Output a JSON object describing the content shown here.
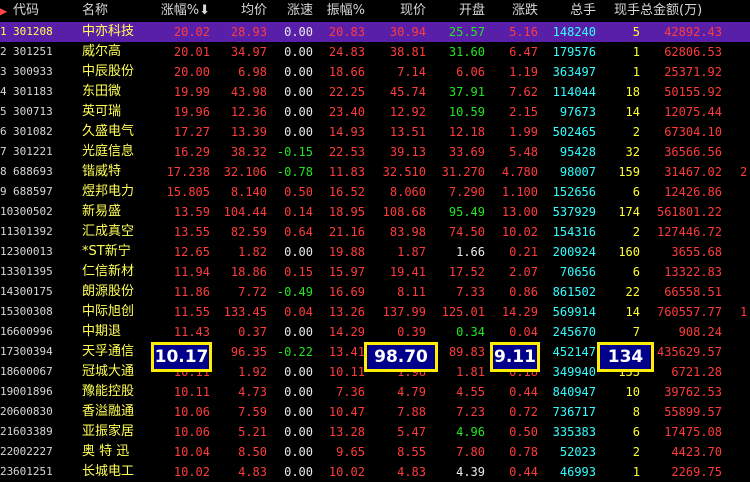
{
  "headers": [
    "代码",
    "名称",
    "涨幅%",
    "均价",
    "涨速",
    "振幅%",
    "现价",
    "开盘",
    "涨跌",
    "总手",
    "现手",
    "总金额(万)"
  ],
  "sort_icon": "sort-desc-arrow-icon",
  "rows": [
    {
      "n": "1",
      "code": "301208",
      "name": "中亦科技",
      "pct": "20.02",
      "avg": "28.93",
      "spd": "0.00",
      "amp": "20.83",
      "px": "30.94",
      "open": "25.57",
      "chg": "5.16",
      "vol": "148240",
      "cur": "5",
      "amt": "42892.43",
      "ext": "",
      "selected": true
    },
    {
      "n": "2",
      "code": "301251",
      "name": "威尔高",
      "pct": "20.01",
      "avg": "34.97",
      "spd": "0.00",
      "amp": "24.83",
      "px": "38.81",
      "open": "31.60",
      "chg": "6.47",
      "vol": "179576",
      "cur": "1",
      "amt": "62806.53",
      "ext": ""
    },
    {
      "n": "3",
      "code": "300933",
      "name": "中辰股份",
      "pct": "20.00",
      "avg": "6.98",
      "spd": "0.00",
      "amp": "18.66",
      "px": "7.14",
      "open": "6.06",
      "chg": "1.19",
      "vol": "363497",
      "cur": "1",
      "amt": "25371.92",
      "ext": ""
    },
    {
      "n": "4",
      "code": "301183",
      "name": "东田微",
      "pct": "19.99",
      "avg": "43.98",
      "spd": "0.00",
      "amp": "22.25",
      "px": "45.74",
      "open": "37.91",
      "chg": "7.62",
      "vol": "114044",
      "cur": "18",
      "amt": "50155.92",
      "ext": ""
    },
    {
      "n": "5",
      "code": "300713",
      "name": "英可瑞",
      "pct": "19.96",
      "avg": "12.36",
      "spd": "0.00",
      "amp": "23.40",
      "px": "12.92",
      "open": "10.59",
      "chg": "2.15",
      "vol": "97673",
      "cur": "14",
      "amt": "12075.44",
      "ext": ""
    },
    {
      "n": "6",
      "code": "301082",
      "name": "久盛电气",
      "pct": "17.27",
      "avg": "13.39",
      "spd": "0.00",
      "amp": "14.93",
      "px": "13.51",
      "open": "12.18",
      "chg": "1.99",
      "vol": "502465",
      "cur": "2",
      "amt": "67304.10",
      "ext": ""
    },
    {
      "n": "7",
      "code": "301221",
      "name": "光庭信息",
      "pct": "16.29",
      "avg": "38.32",
      "spd": "-0.15",
      "amp": "22.53",
      "px": "39.13",
      "open": "33.69",
      "chg": "5.48",
      "vol": "95428",
      "cur": "32",
      "amt": "36566.56",
      "ext": ""
    },
    {
      "n": "8",
      "code": "688693",
      "name": "锴威特",
      "pct": "17.238",
      "avg": "32.106",
      "spd": "-0.78",
      "amp": "11.83",
      "px": "32.510",
      "open": "31.270",
      "chg": "4.780",
      "vol": "98007",
      "cur": "159",
      "amt": "31467.02",
      "ext": "2"
    },
    {
      "n": "9",
      "code": "688597",
      "name": "煜邦电力",
      "pct": "15.805",
      "avg": "8.140",
      "spd": "0.50",
      "amp": "16.52",
      "px": "8.060",
      "open": "7.290",
      "chg": "1.100",
      "vol": "152656",
      "cur": "6",
      "amt": "12426.86",
      "ext": ""
    },
    {
      "n": "10",
      "code": "300502",
      "name": "新易盛",
      "pct": "13.59",
      "avg": "104.44",
      "spd": "0.14",
      "amp": "18.95",
      "px": "108.68",
      "open": "95.49",
      "chg": "13.00",
      "vol": "537929",
      "cur": "174",
      "amt": "561801.22",
      "ext": ""
    },
    {
      "n": "11",
      "code": "301392",
      "name": "汇成真空",
      "pct": "13.55",
      "avg": "82.59",
      "spd": "0.64",
      "amp": "21.16",
      "px": "83.98",
      "open": "74.50",
      "chg": "10.02",
      "vol": "154316",
      "cur": "2",
      "amt": "127446.72",
      "ext": ""
    },
    {
      "n": "12",
      "code": "300013",
      "name": "*ST新宁",
      "pct": "12.65",
      "avg": "1.82",
      "spd": "0.00",
      "amp": "19.88",
      "px": "1.87",
      "open": "1.66",
      "chg": "0.21",
      "vol": "200924",
      "cur": "160",
      "amt": "3655.68",
      "ext": ""
    },
    {
      "n": "13",
      "code": "301395",
      "name": "仁信新材",
      "pct": "11.94",
      "avg": "18.86",
      "spd": "0.15",
      "amp": "15.97",
      "px": "19.41",
      "open": "17.52",
      "chg": "2.07",
      "vol": "70656",
      "cur": "6",
      "amt": "13322.83",
      "ext": ""
    },
    {
      "n": "14",
      "code": "300175",
      "name": "朗源股份",
      "pct": "11.86",
      "avg": "7.72",
      "spd": "-0.49",
      "amp": "16.69",
      "px": "8.11",
      "open": "7.33",
      "chg": "0.86",
      "vol": "861502",
      "cur": "22",
      "amt": "66558.51",
      "ext": ""
    },
    {
      "n": "15",
      "code": "300308",
      "name": "中际旭创",
      "pct": "11.55",
      "avg": "133.45",
      "spd": "0.04",
      "amp": "13.26",
      "px": "137.99",
      "open": "125.01",
      "chg": "14.29",
      "vol": "569914",
      "cur": "14",
      "amt": "760557.77",
      "ext": "1"
    },
    {
      "n": "16",
      "code": "600996",
      "name": "中期退",
      "pct": "11.43",
      "avg": "0.37",
      "spd": "0.00",
      "amp": "14.29",
      "px": "0.39",
      "open": "0.34",
      "chg": "0.04",
      "vol": "245670",
      "cur": "7",
      "amt": "908.24",
      "ext": ""
    },
    {
      "n": "17",
      "code": "300394",
      "name": "天孚通信",
      "pct": "10.17",
      "avg": "96.35",
      "spd": "-0.22",
      "amp": "13.41",
      "px": "98.70",
      "open": "89.83",
      "chg": "9.11",
      "vol": "452147",
      "cur": "134",
      "amt": "435629.57",
      "ext": ""
    },
    {
      "n": "18",
      "code": "600067",
      "name": "冠城大通",
      "pct": "10.11",
      "avg": "1.92",
      "spd": "0.00",
      "amp": "10.11",
      "px": "1.96",
      "open": "1.81",
      "chg": "0.18",
      "vol": "349940",
      "cur": "133",
      "amt": "6721.28",
      "ext": ""
    },
    {
      "n": "19",
      "code": "001896",
      "name": "豫能控股",
      "pct": "10.11",
      "avg": "4.73",
      "spd": "0.00",
      "amp": "7.36",
      "px": "4.79",
      "open": "4.55",
      "chg": "0.44",
      "vol": "840947",
      "cur": "10",
      "amt": "39762.53",
      "ext": ""
    },
    {
      "n": "20",
      "code": "600830",
      "name": "香溢融通",
      "pct": "10.06",
      "avg": "7.59",
      "spd": "0.00",
      "amp": "10.47",
      "px": "7.88",
      "open": "7.23",
      "chg": "0.72",
      "vol": "736717",
      "cur": "8",
      "amt": "55899.57",
      "ext": ""
    },
    {
      "n": "21",
      "code": "603389",
      "name": "亚振家居",
      "pct": "10.06",
      "avg": "5.21",
      "spd": "0.00",
      "amp": "13.28",
      "px": "5.47",
      "open": "4.96",
      "chg": "0.50",
      "vol": "335383",
      "cur": "6",
      "amt": "17475.08",
      "ext": ""
    },
    {
      "n": "22",
      "code": "002227",
      "name": "奥 特 迅",
      "pct": "10.04",
      "avg": "8.50",
      "spd": "0.00",
      "amp": "9.65",
      "px": "8.55",
      "open": "7.80",
      "chg": "0.78",
      "vol": "52023",
      "cur": "2",
      "amt": "4423.70",
      "ext": ""
    },
    {
      "n": "23",
      "code": "601251",
      "name": "长城电工",
      "pct": "10.02",
      "avg": "4.83",
      "spd": "0.00",
      "amp": "10.02",
      "px": "4.83",
      "open": "4.39",
      "chg": "0.44",
      "vol": "46993",
      "cur": "1",
      "amt": "2269.75",
      "ext": ""
    }
  ],
  "highlights": [
    {
      "label": "涨幅%",
      "value": "10.17"
    },
    {
      "label": "现价",
      "value": "98.70"
    },
    {
      "label": "涨跌",
      "value": "9.11"
    },
    {
      "label": "现手",
      "value": "134"
    }
  ],
  "colors": {
    "up": "#ff3b3b",
    "down": "#22e622",
    "neutral": "#eaeaea",
    "volume": "#33ffff",
    "name": "#ffff55",
    "selected": "#5a1fa8",
    "highlight_border": "#ffee00",
    "highlight_bg": "#00008a"
  }
}
